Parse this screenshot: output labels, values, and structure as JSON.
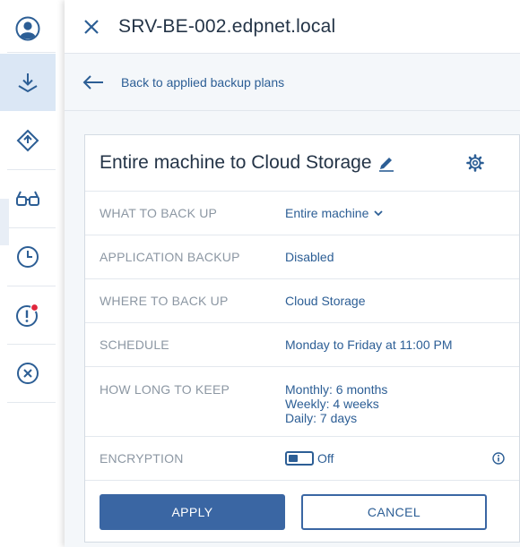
{
  "colors": {
    "accent": "#2c5e95",
    "primary_button": "#3a66a3",
    "alert_dot": "#e0263c",
    "label": "#8c97a3"
  },
  "rail": {
    "items": [
      {
        "icon": "user-icon"
      },
      {
        "icon": "download-icon",
        "active": true
      },
      {
        "icon": "deploy-icon"
      },
      {
        "icon": "glasses-icon"
      },
      {
        "icon": "clock-icon"
      },
      {
        "icon": "alert-icon"
      },
      {
        "icon": "cancel-circle-icon"
      }
    ]
  },
  "header": {
    "title": "SRV-BE-002.edpnet.local"
  },
  "back": {
    "label": "Back to applied backup plans"
  },
  "plan": {
    "title": "Entire machine to Cloud Storage",
    "rows": [
      {
        "label": "WHAT TO BACK UP",
        "value": "Entire machine"
      },
      {
        "label": "APPLICATION BACKUP",
        "value": "Disabled"
      },
      {
        "label": "WHERE TO BACK UP",
        "value": "Cloud Storage"
      },
      {
        "label": "SCHEDULE",
        "value": "Monday to Friday at 11:00 PM"
      },
      {
        "label": "HOW LONG TO KEEP",
        "values": [
          "Monthly: 6 months",
          "Weekly: 4 weeks",
          "Daily: 7 days"
        ]
      },
      {
        "label": "ENCRYPTION",
        "value": "Off"
      }
    ]
  },
  "buttons": {
    "apply": "APPLY",
    "cancel": "CANCEL"
  }
}
